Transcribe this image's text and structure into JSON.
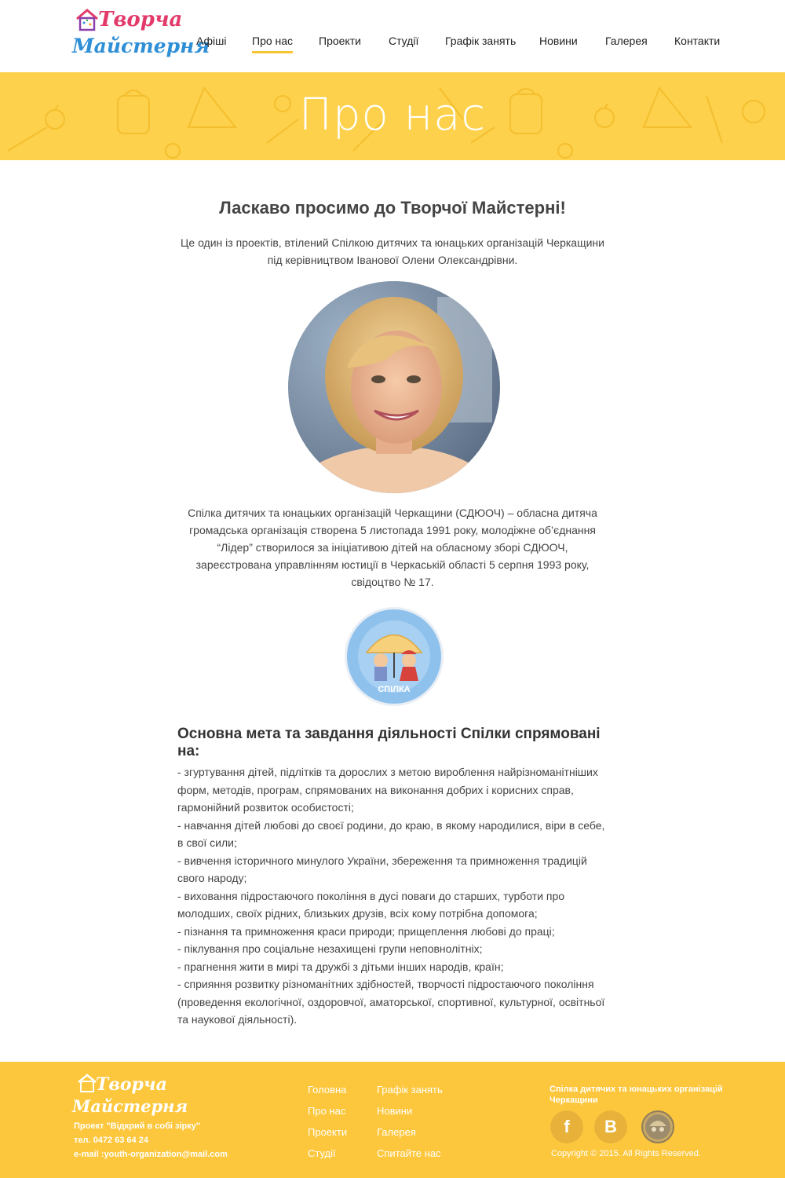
{
  "header": {
    "logo_line1": "Творча",
    "logo_line2": "Майстерня",
    "nav": [
      {
        "label": "Афіші"
      },
      {
        "label": "Про нас"
      },
      {
        "label": "Проекти"
      },
      {
        "label": "Студії"
      },
      {
        "label": "Графік занять"
      },
      {
        "label": "Новини"
      },
      {
        "label": "Галерея"
      },
      {
        "label": "Контакти"
      }
    ],
    "active_nav": "Про нас"
  },
  "banner": {
    "title": "Про нас"
  },
  "main": {
    "welcome_title": "Ласкаво просимо до Творчої Майстерні!",
    "intro_line1": "Це один із проектів, втілений Спілкою дитячих та юнацьких організацій Черкащини",
    "intro_line2": "під керівництвом Іванової Олени Олександрівни.",
    "description": "Спілка дитячих та юнацьких організацій Черкащини (СДЮОЧ) – обласна дитяча громадська організація створена 5 листопада 1991 року, молодіжне об’єднання “Лідер” створилося за ініціативою дітей на обласному зборі СДЮОЧ, зареєстрована управлінням юстиції в Черкаській області 5 серпня 1993 року, свідоцтво № 17.",
    "union_logo_text": "СПІЛКА",
    "goals_title": "Основна мета та завдання діяльності Спілки спрямовані на:",
    "goals": [
      "- згуртування дітей, підлітків та дорослих з метою вироблення найрізноманітніших форм, методів, програм, спрямованих на виконання добрих і корисних справ, гармонійний розвиток особистості;",
      "- навчання дітей любові до своєї родини, до краю, в якому народилися, віри в себе, в свої сили;",
      "- вивчення історичного минулого України, збереження та примноження традицій свого народу;",
      "- виховання підростаючого покоління в дусі поваги до старших, турботи про молодших, своїх рідних, близьких друзів, всіх кому потрібна допомога;",
      "- пізнання та примноження краси природи; прищеплення любові до праці;",
      "- піклування про соціальне незахищені групи неповнолітніх;",
      "- прагнення жити в мирі та дружбі з дітьми інших народів, країн;",
      "- сприяння розвитку різноманітних здібностей, творчості підростаючого покоління (проведення екологічної, оздоровчої, аматорської, спортивної, культурної, освітньої та наукової діяльності)."
    ]
  },
  "footer": {
    "logo_line1": "Творча",
    "logo_line2": "Майстерня",
    "project": "Проект \"Відкрий в собі зірку\"",
    "phone": "тел. 0472 63 64 24",
    "email": "e-mail :youth-organization@mail.com",
    "links_col1": [
      "Головна",
      "Про нас",
      "Проекти",
      "Студії"
    ],
    "links_col2": [
      "Графік занять",
      "Новини",
      "Галерея",
      "Спитайте нас"
    ],
    "org_name": "Спілка дитячих та юнацьких організацій Черкащини",
    "social": [
      "f",
      "B"
    ],
    "copyright": "Copyright © 2015.  All Rights Reserved."
  },
  "colors": {
    "accent_yellow": "#fdd14b",
    "footer_yellow": "#fdc73d",
    "nav_underline": "#f7c533",
    "logo_pink": "#e23b6a",
    "logo_blue": "#2f8fd6"
  }
}
